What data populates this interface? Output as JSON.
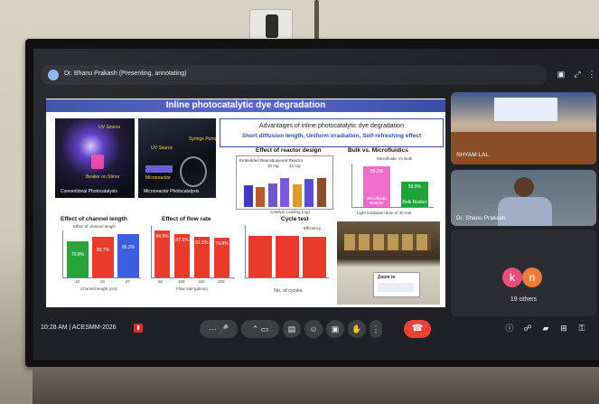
{
  "meeting": {
    "presenter_label": "Dr. Bhanu Prakash (Presenting, annotating)",
    "time": "10:28 AM",
    "separator": "|",
    "meeting_code": "ACESMM-2026"
  },
  "slide": {
    "title": "Inline photocatalytic dye degradation",
    "photo1": {
      "uv": "UV Source",
      "beaker": "Beaker on Stirrer",
      "caption": "Conventional Photocatalysis"
    },
    "photo2": {
      "uv": "UV Source",
      "syringe": "Syringe Pump",
      "reactor": "Microreactor",
      "caption": "Microreactor Photocatalysis"
    },
    "advantages": {
      "line1": "Advantages of inline photocatalytic dye degradation",
      "line2": "Short diffusion length, Uniform irradiation, Self-refreshing effect"
    },
    "reactor_design": {
      "title": "Effect of reactor design",
      "ylabel": "Efficiency (%)",
      "xlabel": "Catalyst Loading (mg)",
      "legend": [
        "Embedded Reactor",
        "Layered Reactor",
        "16 mg",
        "10 mg"
      ],
      "values": [
        62.45,
        58.91,
        69.21,
        84.32,
        67.06,
        82.7,
        83.5
      ],
      "colors": [
        "#3f3ac0",
        "#b65a2c",
        "#6d58c4",
        "#7a5ad8",
        "#e39a24",
        "#5b4ed0",
        "#8d4e2a"
      ]
    },
    "bulk_micro": {
      "title": "Bulk vs. Microfluidics",
      "legend": "Microfluidic Vs Bulk",
      "ylabel": "Degradation Efficiency (%)",
      "bar1": {
        "value": "95.3%",
        "label": "Microfluidic Reactor",
        "height": 95.3,
        "color": "#ee6ec8"
      },
      "bar2": {
        "value": "58.8%",
        "label": "Bulk Beaker",
        "height": 58.8,
        "color": "#1ea53a"
      },
      "xlabel": "Light irradiation time of 30 min"
    },
    "channel_length": {
      "title": "Effect of channel length",
      "subtitle": "Effect of channel length",
      "ylabel": "Degradation Efficiency",
      "xlabel": "Channel length (cm)",
      "bars": [
        {
          "value": "79.8%",
          "tick": "10",
          "height": 79.8,
          "color": "#2aa33a"
        },
        {
          "value": "90.7%",
          "tick": "20",
          "height": 90.7,
          "color": "#ea3a2c"
        },
        {
          "value": "95.3%",
          "tick": "27",
          "height": 95.3,
          "color": "#3b5fe0"
        }
      ]
    },
    "flow_rate": {
      "title": "Effect of flow rate",
      "ylabel": "Degradation Efficiency (%)",
      "xlabel": "Flow rate (µl/min)",
      "bars": [
        {
          "value": "94.5%",
          "tick": "50",
          "height": 94.5
        },
        {
          "value": "87.5%",
          "tick": "100",
          "height": 87.5
        },
        {
          "value": "81.5%",
          "tick": "150",
          "height": 81.5
        },
        {
          "value": "79.8%",
          "tick": "200",
          "height": 79.8
        }
      ],
      "color": "#ea3a2c"
    },
    "cycle_test": {
      "title": "Cycle test",
      "ylabel": "Efficiency (%)",
      "xlabel": "No. of cycles",
      "legend": "Efficiency",
      "heights": [
        96,
        95,
        94
      ],
      "color": "#ea3a2c"
    },
    "zoom_label": "Zoom in"
  },
  "tiles": {
    "tile1_name": "SHYAM LAL",
    "tile2_name": "Dr. Shanu Prakash",
    "others_count": "19 others",
    "avatar1": {
      "letter": "k",
      "color": "#e94f7a"
    },
    "avatar2": {
      "letter": "n",
      "color": "#f07a3a"
    }
  }
}
